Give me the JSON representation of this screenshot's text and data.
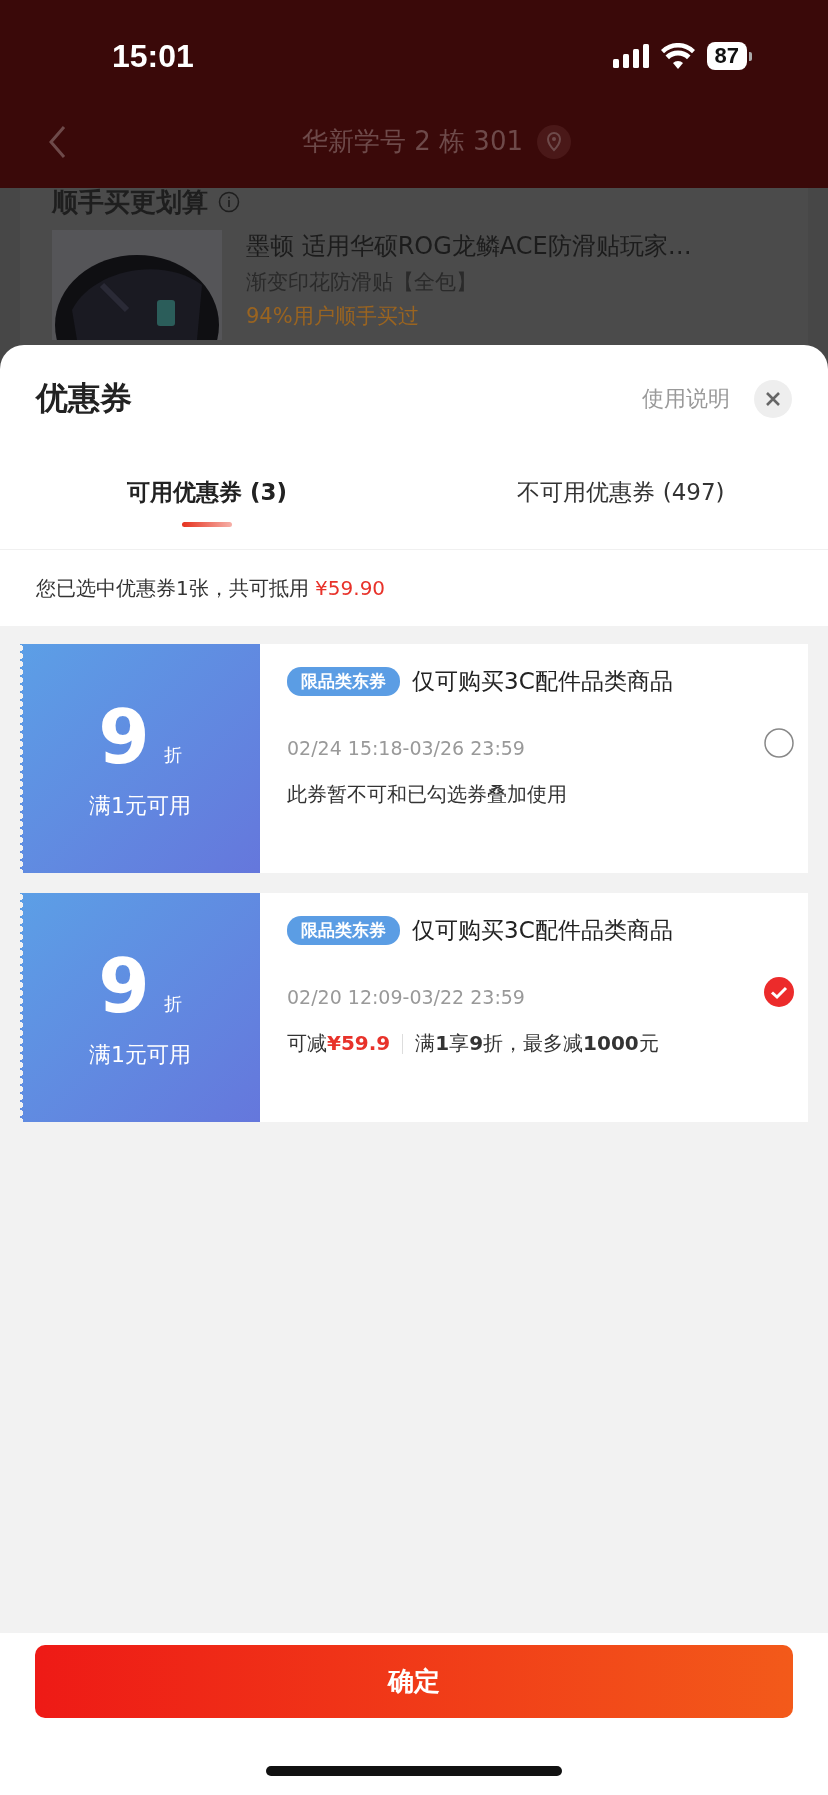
{
  "status_bar": {
    "time": "15:01",
    "battery": "87"
  },
  "nav": {
    "title": "华新学号 2 栋 301"
  },
  "background": {
    "section_title": "顺手买更划算",
    "product": {
      "title": "墨顿 适用华硕ROG龙鳞ACE防滑贴玩家…",
      "spec": "渐变印花防滑贴【全包】",
      "note": "94%用户顺手买过"
    }
  },
  "sheet": {
    "title": "优惠券",
    "help_link": "使用说明",
    "tabs": [
      {
        "label": "可用优惠券 (3)",
        "selected": true
      },
      {
        "label": "不可用优惠券 (497)",
        "selected": false
      }
    ],
    "summary": {
      "text": "您已选中优惠券1张，共可抵用",
      "amount": "¥59.90"
    },
    "coupons": [
      {
        "kind": "note",
        "value": "9",
        "unit": "折",
        "threshold": "满1元可用",
        "tag": "限品类东券",
        "scope": "仅可购买3C配件品类商品",
        "validity": "02/24 15:18-03/26 23:59",
        "note": "此券暂不可和已勾选券叠加使用",
        "selected": false
      },
      {
        "kind": "savings",
        "value": "9",
        "unit": "折",
        "threshold": "满1元可用",
        "tag": "限品类东券",
        "scope": "仅可购买3C配件品类商品",
        "validity": "02/20 12:09-03/22 23:59",
        "saving_label": "可减",
        "saving_amount": "¥59.9",
        "rule": "满**1**享**9**折，最多减**1000**元",
        "selected": true
      }
    ],
    "confirm_button": "确定"
  }
}
